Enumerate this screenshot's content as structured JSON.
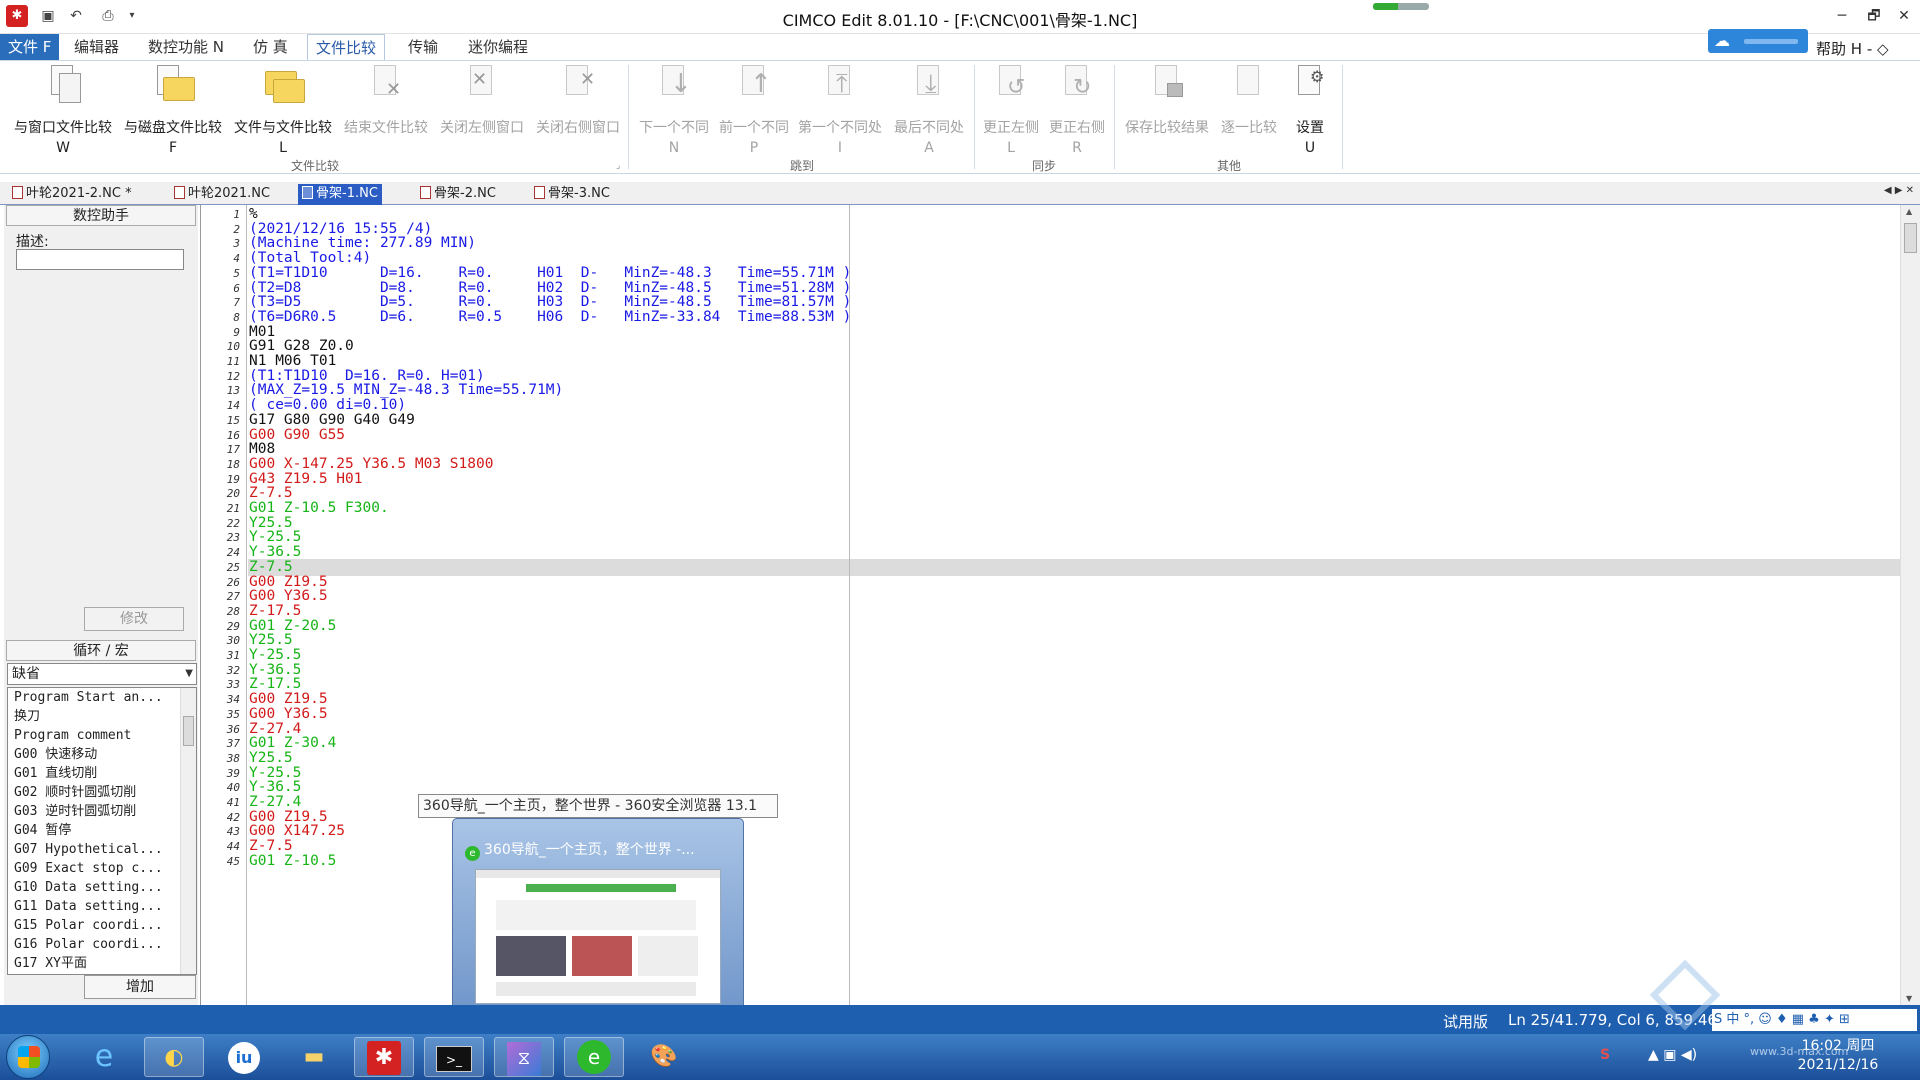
{
  "window": {
    "title": "CIMCO Edit 8.01.10 - [F:\\CNC\\001\\骨架-1.NC]",
    "minimize_glyph": "─",
    "restore_glyph": "🗗",
    "close_glyph": "✕",
    "quick_access_icons": [
      "save-icon",
      "undo-icon",
      "print-icon",
      "customize-icon"
    ],
    "progress_fraction": 0.45
  },
  "menu": {
    "tabs": [
      "文件 F",
      "编辑器",
      "数控功能 N",
      "仿 真",
      "文件比较",
      "传输",
      "迷你编程"
    ],
    "active_tab": "文件比较",
    "help": "帮助 H",
    "help_extras": "-  ◇"
  },
  "ribbon": {
    "groups": [
      {
        "label": "文件比较",
        "buttons": [
          {
            "label": "与窗口文件比较",
            "key": "W",
            "enabled": true
          },
          {
            "label": "与磁盘文件比较",
            "key": "F",
            "enabled": true
          },
          {
            "label": "文件与文件比较",
            "key": "L",
            "enabled": true
          },
          {
            "label": "结束文件比较",
            "key": "",
            "enabled": false
          },
          {
            "label": "关闭左侧窗口",
            "key": "",
            "enabled": false
          },
          {
            "label": "关闭右侧窗口",
            "key": "",
            "enabled": false
          }
        ]
      },
      {
        "label": "跳到",
        "buttons": [
          {
            "label": "下一个不同",
            "key": "N",
            "enabled": false
          },
          {
            "label": "前一个不同",
            "key": "P",
            "enabled": false
          },
          {
            "label": "第一个不同处",
            "key": "I",
            "enabled": false
          },
          {
            "label": "最后不同处",
            "key": "A",
            "enabled": false
          }
        ]
      },
      {
        "label": "同步",
        "buttons": [
          {
            "label": "更正左侧",
            "key": "L",
            "enabled": false
          },
          {
            "label": "更正右侧",
            "key": "R",
            "enabled": false
          }
        ]
      },
      {
        "label": "其他",
        "buttons": [
          {
            "label": "保存比较结果",
            "key": "",
            "enabled": false
          },
          {
            "label": "逐一比较",
            "key": "",
            "enabled": false
          },
          {
            "label": "设置",
            "key": "U",
            "enabled": true
          }
        ]
      }
    ]
  },
  "doc_tabs": [
    {
      "label": "叶轮2021-2.NC *",
      "active": false
    },
    {
      "label": "叶轮2021.NC",
      "active": false
    },
    {
      "label": "骨架-1.NC",
      "active": true
    },
    {
      "label": "骨架-2.NC",
      "active": false
    },
    {
      "label": "骨架-3.NC",
      "active": false
    }
  ],
  "left_panel": {
    "assistant_title": "数控助手",
    "desc_label": "描述:",
    "desc_value": "",
    "modify_button": "修改",
    "cycle_title": "循环 / 宏",
    "cycle_combo": "缺省",
    "cycle_items": [
      "Program Start an...",
      "换刀",
      "Program comment",
      "G00 快速移动",
      "G01 直线切削",
      "G02 顺时针圆弧切削",
      "G03 逆时针圆弧切削",
      "G04 暂停",
      "G07 Hypothetical...",
      "G09 Exact stop c...",
      "G10 Data setting...",
      "G11 Data setting...",
      "G15 Polar coordi...",
      "G16 Polar coordi...",
      "G17 XY平面"
    ],
    "add_button": "增加"
  },
  "editor": {
    "current_line": 25,
    "colors": {
      "comment": "#1a1ae6",
      "rapid": "#d21a1a",
      "feed": "#16b416",
      "plain": "#111111"
    },
    "lines": [
      {
        "n": "1",
        "text": "%",
        "kind": "plain"
      },
      {
        "n": "2",
        "text": "(2021/12/16 15:55 /4)",
        "kind": "comment"
      },
      {
        "n": "3",
        "text": "(Machine time: 277.89 MIN)",
        "kind": "comment"
      },
      {
        "n": "4",
        "text": "(Total Tool:4)",
        "kind": "comment"
      },
      {
        "n": "5",
        "text": "(T1=T1D10      D=16.    R=0.     H01  D-   MinZ=-48.3   Time=55.71M )",
        "kind": "comment"
      },
      {
        "n": "6",
        "text": "(T2=D8         D=8.     R=0.     H02  D-   MinZ=-48.5   Time=51.28M )",
        "kind": "comment"
      },
      {
        "n": "7",
        "text": "(T3=D5         D=5.     R=0.     H03  D-   MinZ=-48.5   Time=81.57M )",
        "kind": "comment"
      },
      {
        "n": "8",
        "text": "(T6=D6R0.5     D=6.     R=0.5    H06  D-   MinZ=-33.84  Time=88.53M )",
        "kind": "comment"
      },
      {
        "n": "9",
        "text": "M01",
        "kind": "plain"
      },
      {
        "n": "10",
        "text": "G91 G28 Z0.0",
        "kind": "plain"
      },
      {
        "n": "11",
        "text": "N1 M06 T01",
        "kind": "plain"
      },
      {
        "n": "12",
        "text": "(T1:T1D10  D=16. R=0. H=01)",
        "kind": "comment"
      },
      {
        "n": "13",
        "text": "(MAX_Z=19.5 MIN_Z=-48.3 Time=55.71M)",
        "kind": "comment"
      },
      {
        "n": "14",
        "text": "( ce=0.00 di=0.10)",
        "kind": "comment"
      },
      {
        "n": "15",
        "text": "G17 G80 G90 G40 G49",
        "kind": "plain"
      },
      {
        "n": "16",
        "text": "G00 G90 G55",
        "kind": "rapid"
      },
      {
        "n": "17",
        "text": "M08",
        "kind": "plain"
      },
      {
        "n": "18",
        "text": "G00 X-147.25 Y36.5 M03 S1800",
        "kind": "rapid"
      },
      {
        "n": "19",
        "text": "G43 Z19.5 H01",
        "kind": "rapid"
      },
      {
        "n": "20",
        "text": "Z-7.5",
        "kind": "rapid"
      },
      {
        "n": "21",
        "text": "G01 Z-10.5 F300.",
        "kind": "feed"
      },
      {
        "n": "22",
        "text": "Y25.5",
        "kind": "feed"
      },
      {
        "n": "23",
        "text": "Y-25.5",
        "kind": "feed"
      },
      {
        "n": "24",
        "text": "Y-36.5",
        "kind": "feed"
      },
      {
        "n": "25",
        "text": "Z-7.5",
        "kind": "feed"
      },
      {
        "n": "26",
        "text": "G00 Z19.5",
        "kind": "rapid"
      },
      {
        "n": "27",
        "text": "G00 Y36.5",
        "kind": "rapid"
      },
      {
        "n": "28",
        "text": "Z-17.5",
        "kind": "rapid"
      },
      {
        "n": "29",
        "text": "G01 Z-20.5",
        "kind": "feed"
      },
      {
        "n": "30",
        "text": "Y25.5",
        "kind": "feed"
      },
      {
        "n": "31",
        "text": "Y-25.5",
        "kind": "feed"
      },
      {
        "n": "32",
        "text": "Y-36.5",
        "kind": "feed"
      },
      {
        "n": "33",
        "text": "Z-17.5",
        "kind": "feed"
      },
      {
        "n": "34",
        "text": "G00 Z19.5",
        "kind": "rapid"
      },
      {
        "n": "35",
        "text": "G00 Y36.5",
        "kind": "rapid"
      },
      {
        "n": "36",
        "text": "Z-27.4",
        "kind": "rapid"
      },
      {
        "n": "37",
        "text": "G01 Z-30.4",
        "kind": "feed"
      },
      {
        "n": "38",
        "text": "Y25.5",
        "kind": "feed"
      },
      {
        "n": "39",
        "text": "Y-25.5",
        "kind": "feed"
      },
      {
        "n": "40",
        "text": "Y-36.5",
        "kind": "feed"
      },
      {
        "n": "41",
        "text": "Z-27.4",
        "kind": "feed"
      },
      {
        "n": "42",
        "text": "G00 Z19.5",
        "kind": "rapid"
      },
      {
        "n": "43",
        "text": "G00 X147.25",
        "kind": "rapid"
      },
      {
        "n": "44",
        "text": "Z-7.5",
        "kind": "rapid"
      },
      {
        "n": "45",
        "text": "G01 Z-10.5",
        "kind": "feed"
      }
    ]
  },
  "tooltip": "360导航_一个主页，整个世界 - 360安全浏览器 13.1",
  "taskbar_preview": {
    "title": "360导航_一个主页，整个世界 -..."
  },
  "status": {
    "trial": "试用版",
    "position": "Ln 25/41.779, Col 6, 859.469",
    "ime": "S 中 °, ☺ ♦ ▦ ♣ ✦ ⊞"
  },
  "taskbar": {
    "apps": [
      "ie-icon",
      "app-swirl-icon",
      "iw-icon",
      "folder-icon",
      "cimco-icon",
      "terminal-icon",
      "vs-icon",
      "browser-360-icon",
      "paint-icon"
    ],
    "clock_time": "16:02 周四",
    "clock_date": "2021/12/16",
    "tray_extras": "▲  ▣  ◀)",
    "watermark": "www.3d-max.com"
  }
}
